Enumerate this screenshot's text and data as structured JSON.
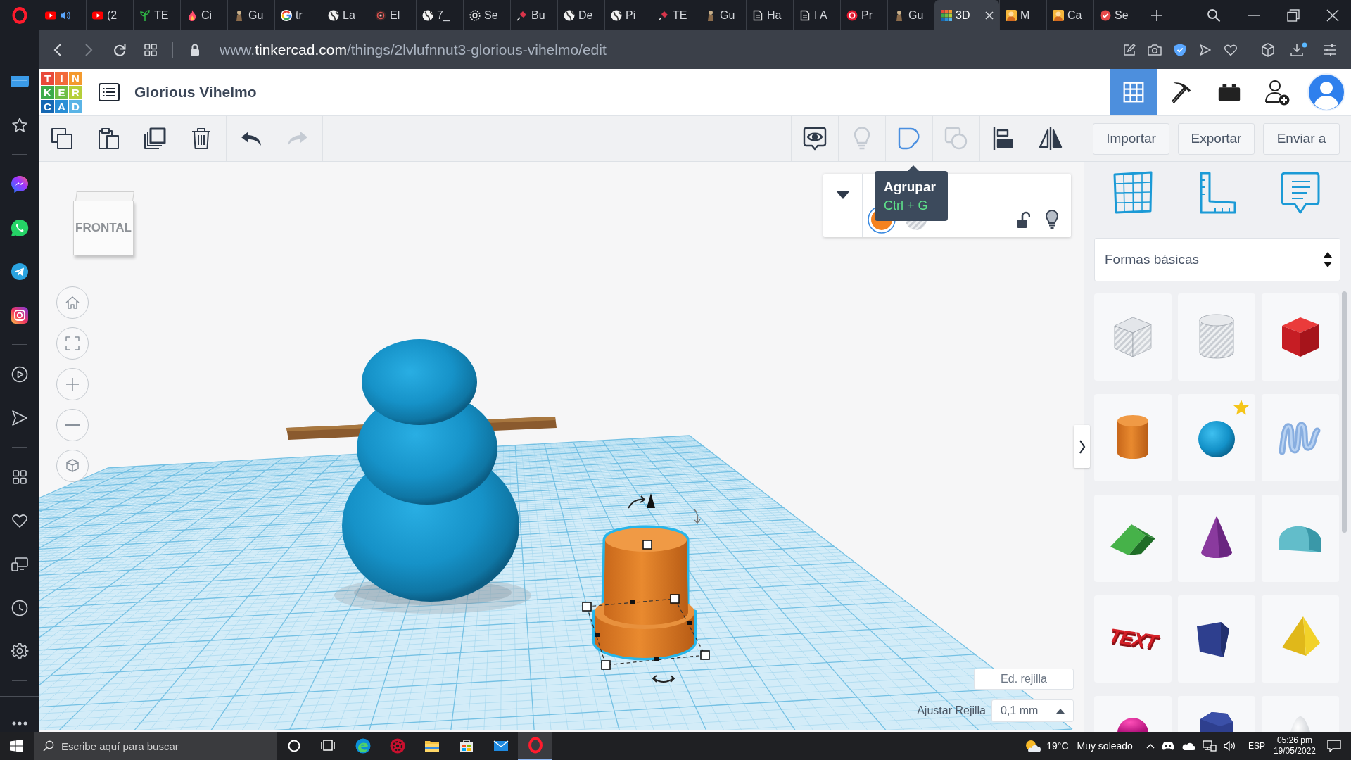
{
  "browser": {
    "tabs": [
      {
        "kind": "video",
        "audio": true,
        "selected": false
      },
      {
        "kind": "video",
        "label": "(2",
        "audio": false,
        "selected": false
      },
      {
        "kind": "sprout",
        "label": "TE",
        "audio": false,
        "selected": false
      },
      {
        "kind": "flame",
        "label": "Ci",
        "audio": false,
        "selected": false
      },
      {
        "kind": "figure",
        "label": "Gu",
        "audio": false,
        "selected": false
      },
      {
        "kind": "ring",
        "label": "tr",
        "audio": false,
        "selected": false
      },
      {
        "kind": "globe",
        "label": "La",
        "audio": false,
        "selected": false
      },
      {
        "kind": "target",
        "label": "El",
        "audio": false,
        "selected": false
      },
      {
        "kind": "globe",
        "label": "7_",
        "audio": false,
        "selected": false
      },
      {
        "kind": "compass",
        "label": "Se",
        "audio": false,
        "selected": false
      },
      {
        "kind": "pin",
        "label": "Bu",
        "audio": false,
        "selected": false
      },
      {
        "kind": "globe",
        "label": "De",
        "audio": false,
        "selected": false
      },
      {
        "kind": "globe",
        "label": "Pi",
        "audio": false,
        "selected": false
      },
      {
        "kind": "pin",
        "label": "TE",
        "audio": false,
        "selected": false
      },
      {
        "kind": "figure",
        "label": "Gu",
        "audio": false,
        "selected": false
      },
      {
        "kind": "page",
        "label": "Ha",
        "audio": false,
        "selected": false
      },
      {
        "kind": "page",
        "label": "I A",
        "audio": false,
        "selected": false
      },
      {
        "kind": "stop",
        "label": "Pr",
        "audio": false,
        "selected": false
      },
      {
        "kind": "figure",
        "label": "Gu",
        "audio": false,
        "selected": false
      },
      {
        "kind": "tiles",
        "label": "3D",
        "audio": false,
        "selected": true
      },
      {
        "kind": "cartoon",
        "label": "M",
        "audio": false,
        "selected": false
      },
      {
        "kind": "cartoon",
        "label": "Ca",
        "audio": false,
        "selected": false
      },
      {
        "kind": "check",
        "label": "Se",
        "audio": false,
        "selected": false
      }
    ],
    "address": {
      "prefix": "www.",
      "domain": "tinkercad.com",
      "path": "/things/2lvlufnnut3-glorious-vihelmo/edit"
    }
  },
  "sidebar": {
    "items": [
      {
        "kind": "app"
      },
      {
        "kind": "bookmarks"
      },
      {
        "kind": "divider"
      },
      {
        "kind": "chat"
      },
      {
        "kind": "phone-chat"
      },
      {
        "kind": "plane"
      },
      {
        "kind": "camera"
      },
      {
        "kind": "divider"
      },
      {
        "kind": "player"
      },
      {
        "kind": "send"
      },
      {
        "kind": "divider"
      },
      {
        "kind": "workspaces"
      },
      {
        "kind": "favorites"
      },
      {
        "kind": "devices"
      },
      {
        "kind": "history"
      },
      {
        "kind": "settings"
      },
      {
        "kind": "divider"
      },
      {
        "kind": "more"
      }
    ]
  },
  "app": {
    "logo": [
      {
        "letter": "T",
        "color": "#e8493a"
      },
      {
        "letter": "I",
        "color": "#f26a3a"
      },
      {
        "letter": "N",
        "color": "#f49a2e"
      },
      {
        "letter": "K",
        "color": "#3cab4a"
      },
      {
        "letter": "E",
        "color": "#6fbe44"
      },
      {
        "letter": "R",
        "color": "#b5cf3a"
      },
      {
        "letter": "C",
        "color": "#1668b3"
      },
      {
        "letter": "A",
        "color": "#2a8fd6"
      },
      {
        "letter": "D",
        "color": "#5ab4e6"
      }
    ],
    "title": "Glorious Vihelmo",
    "views": [
      {
        "kind": "grid",
        "selected": true
      },
      {
        "kind": "pickaxe",
        "selected": false
      },
      {
        "kind": "bricks",
        "selected": false
      }
    ]
  },
  "toolbar": {
    "edit": [
      {
        "kind": "copy",
        "disabled": false
      },
      {
        "kind": "paste",
        "disabled": false
      },
      {
        "kind": "duplicate",
        "disabled": false
      },
      {
        "kind": "delete",
        "disabled": false
      }
    ],
    "history": [
      {
        "kind": "undo",
        "disabled": false
      },
      {
        "kind": "redo",
        "disabled": true
      }
    ],
    "shape": [
      {
        "kind": "notes",
        "disabled": false,
        "active": false
      },
      {
        "kind": "bulb",
        "disabled": true,
        "active": false
      },
      {
        "kind": "group",
        "disabled": false,
        "active": true
      },
      {
        "kind": "ungroup",
        "disabled": true,
        "active": false
      },
      {
        "kind": "align",
        "disabled": false,
        "active": false
      },
      {
        "kind": "mirror",
        "disabled": false,
        "active": false
      }
    ],
    "actions": [
      "Importar",
      "Exportar",
      "Enviar a"
    ]
  },
  "tooltip": {
    "title": "Agrupar",
    "shortcut": "Ctrl + G"
  },
  "inspector": {
    "expanded": true,
    "swatches": [
      {
        "kind": "solid",
        "color": "#f5821f",
        "selected": true
      },
      {
        "kind": "hole",
        "selected": false
      }
    ],
    "locked": false
  },
  "view_cube": {
    "face": "FRONTAL"
  },
  "view_controls": [
    {
      "kind": "home"
    },
    {
      "kind": "fit"
    },
    {
      "kind": "zoom-in"
    },
    {
      "kind": "zoom-out"
    },
    {
      "kind": "perspective"
    }
  ],
  "scene": {
    "objects": [
      {
        "kind": "snowman",
        "selected": false
      },
      {
        "kind": "stacked-cylinder",
        "selected": true
      }
    ]
  },
  "grid": {
    "edit_button": "Ed. rejilla",
    "snap_label": "Ajustar Rejilla",
    "snap_value": "0,1 mm"
  },
  "panel": {
    "tools": [
      {
        "kind": "workplane"
      },
      {
        "kind": "ruler"
      },
      {
        "kind": "notes"
      }
    ],
    "library": "Formas básicas",
    "shapes": [
      {
        "kind": "box-hole",
        "favorite": false
      },
      {
        "kind": "cylinder-hole",
        "favorite": false
      },
      {
        "kind": "box",
        "favorite": false
      },
      {
        "kind": "cylinder",
        "favorite": false
      },
      {
        "kind": "sphere",
        "favorite": true
      },
      {
        "kind": "scribble",
        "favorite": false
      },
      {
        "kind": "roof",
        "favorite": false
      },
      {
        "kind": "cone",
        "favorite": false
      },
      {
        "kind": "round-roof",
        "favorite": false
      },
      {
        "kind": "text",
        "text": "TEXT",
        "favorite": false
      },
      {
        "kind": "prism",
        "favorite": false
      },
      {
        "kind": "pyramid",
        "favorite": false
      },
      {
        "kind": "dome",
        "favorite": false
      },
      {
        "kind": "polygon",
        "favorite": false
      },
      {
        "kind": "paraboloid",
        "favorite": false
      }
    ]
  },
  "taskbar": {
    "search": {
      "placeholder": "Escribe aquí para buscar"
    },
    "apps": [
      {
        "kind": "cortana",
        "selected": false
      },
      {
        "kind": "task-view",
        "selected": false
      },
      {
        "kind": "edge",
        "selected": false
      },
      {
        "kind": "red-app",
        "selected": false
      },
      {
        "kind": "explorer",
        "selected": false
      },
      {
        "kind": "store",
        "selected": false
      },
      {
        "kind": "mail",
        "selected": false
      },
      {
        "kind": "opera",
        "selected": true
      }
    ],
    "weather": {
      "temperature": "19°C",
      "condition": "Muy soleado"
    },
    "language": "ESP",
    "time": "05:26 pm",
    "date": "19/05/2022"
  }
}
